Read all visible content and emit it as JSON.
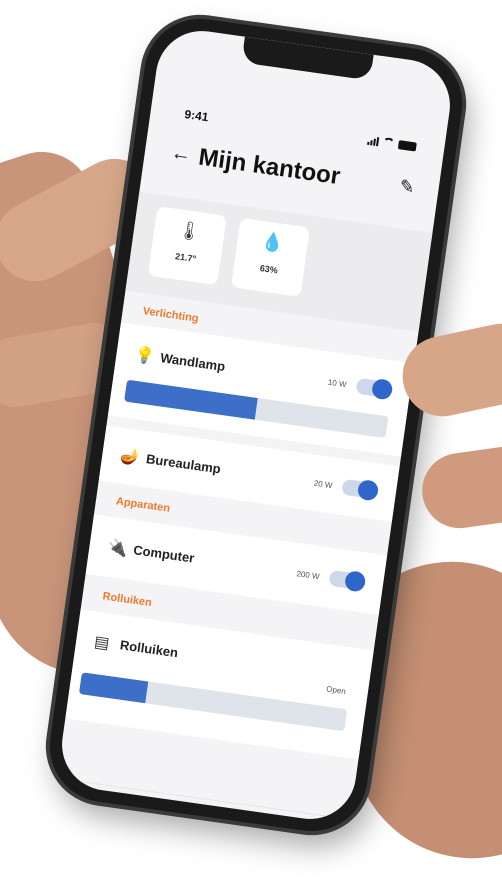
{
  "status_bar": {
    "time": "9:41"
  },
  "header": {
    "title": "Mijn kantoor",
    "back_icon": "arrow-left-icon",
    "edit_icon": "pencil-icon"
  },
  "sensors": [
    {
      "icon": "thermometer-icon",
      "value": "21.7°"
    },
    {
      "icon": "droplet-icon",
      "value": "63%"
    }
  ],
  "sections": {
    "verlichting": "Verlichting",
    "apparaten": "Apparaten",
    "rolluiken": "Rolluiken"
  },
  "devices": {
    "wandlamp": {
      "name": "Wandlamp",
      "power": "10 W",
      "on": true,
      "brightness": 0.5
    },
    "bureaulamp": {
      "name": "Bureaulamp",
      "power": "20 W",
      "on": true
    },
    "computer": {
      "name": "Computer",
      "power": "200 W",
      "on": true
    },
    "rolluiken": {
      "name": "Rolluiken",
      "state": "Open",
      "position": 0.25
    }
  },
  "colors": {
    "accent": "#2e67c9",
    "section": "#f07a2c"
  }
}
